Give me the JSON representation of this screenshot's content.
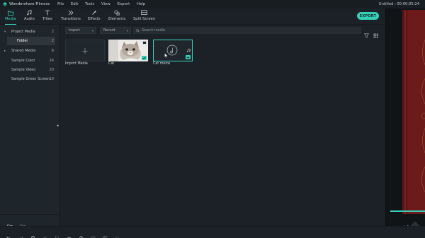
{
  "app": {
    "name": "Wondershare Filmora",
    "doc_title": "Untitled : 00:00:05:24"
  },
  "menu": [
    "File",
    "Edit",
    "Tools",
    "View",
    "Export",
    "Help"
  ],
  "tabs": [
    {
      "label": "Media",
      "icon": "folder-icon",
      "active": true
    },
    {
      "label": "Audio",
      "icon": "music-note-icon",
      "active": false
    },
    {
      "label": "Titles",
      "icon": "text-t-icon",
      "active": false
    },
    {
      "label": "Transitions",
      "icon": "transition-icon",
      "active": false
    },
    {
      "label": "Effects",
      "icon": "effects-icon",
      "active": false
    },
    {
      "label": "Elements",
      "icon": "elements-icon",
      "active": false
    },
    {
      "label": "Split Screen",
      "icon": "split-screen-icon",
      "active": false
    }
  ],
  "export_label": "EXPORT",
  "sidebar": {
    "items": [
      {
        "label": "Project Media",
        "count": "2",
        "expanded": true
      },
      {
        "label": "Folder",
        "count": "2",
        "selected": true
      },
      {
        "label": "Shared Media",
        "count": "6",
        "expanded": false
      },
      {
        "label": "Sample Color",
        "count": "24"
      },
      {
        "label": "Sample Video",
        "count": "20"
      },
      {
        "label": "Sample Green Screen",
        "count": "10"
      }
    ]
  },
  "media": {
    "import_dropdown": "Import",
    "record_dropdown": "Record",
    "search_placeholder": "Search media",
    "items": [
      {
        "label": "Import Media",
        "type": "import"
      },
      {
        "label": "Cat",
        "type": "video",
        "added": true
      },
      {
        "label": "Cat meow",
        "type": "audio",
        "selected": true
      }
    ]
  },
  "preview": {
    "progress": 1.0
  },
  "colors": {
    "accent": "#35cfb7",
    "panel": "#1e252b",
    "background": "#1b2127"
  }
}
